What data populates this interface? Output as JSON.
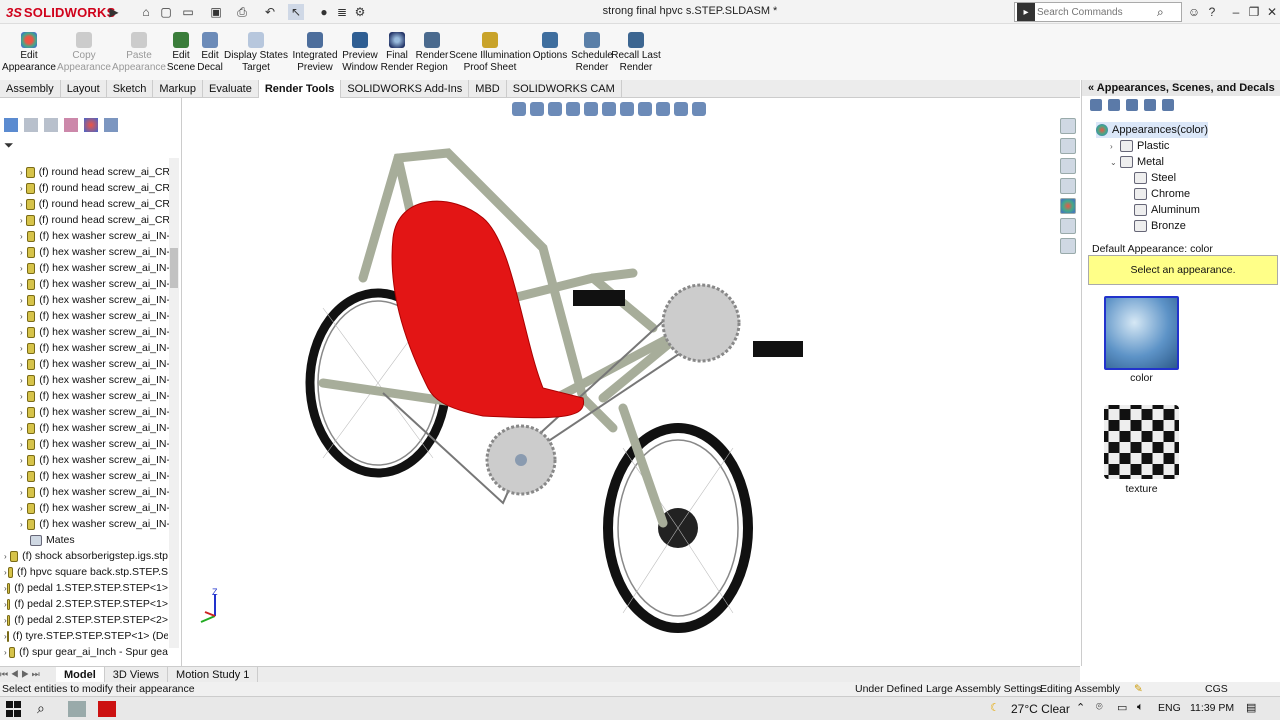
{
  "app": {
    "logo_ds": "3S",
    "logo_sw": "SOLIDWORKS",
    "doc_title": "strong final hpvc s.STEP.SLDASM *"
  },
  "search": {
    "placeholder": "Search Commands"
  },
  "commands": [
    {
      "label": "Edit\nAppearance",
      "enabled": true
    },
    {
      "label": "Copy\nAppearance",
      "enabled": false
    },
    {
      "label": "Paste\nAppearance",
      "enabled": false
    },
    {
      "label": "Edit\nScene",
      "enabled": true
    },
    {
      "label": "Edit\nDecal",
      "enabled": true
    },
    {
      "label": "Display States\nTarget",
      "enabled": true
    },
    {
      "label": "Integrated\nPreview",
      "enabled": true
    },
    {
      "label": "Preview\nWindow",
      "enabled": true
    },
    {
      "label": "Final\nRender",
      "enabled": true
    },
    {
      "label": "Render\nRegion",
      "enabled": true
    },
    {
      "label": "Scene Illumination\nProof Sheet",
      "enabled": true
    },
    {
      "label": "Options",
      "enabled": true
    },
    {
      "label": "Schedule\nRender",
      "enabled": true
    },
    {
      "label": "Recall Last\nRender",
      "enabled": true
    }
  ],
  "tabs": [
    "Assembly",
    "Layout",
    "Sketch",
    "Markup",
    "Evaluate",
    "Render Tools",
    "SOLIDWORKS Add-Ins",
    "MBD",
    "SOLIDWORKS CAM"
  ],
  "active_tab": "Render Tools",
  "tree": {
    "nested_items": [
      "(f) round head screw_ai_CR",
      "(f) round head screw_ai_CR",
      "(f) round head screw_ai_CR",
      "(f) round head screw_ai_CR",
      "(f) hex washer screw_ai_IN-",
      "(f) hex washer screw_ai_IN-",
      "(f) hex washer screw_ai_IN-",
      "(f) hex washer screw_ai_IN-",
      "(f) hex washer screw_ai_IN-",
      "(f) hex washer screw_ai_IN-",
      "(f) hex washer screw_ai_IN-",
      "(f) hex washer screw_ai_IN-",
      "(f) hex washer screw_ai_IN-",
      "(f) hex washer screw_ai_IN-",
      "(f) hex washer screw_ai_IN-",
      "(f) hex washer screw_ai_IN-",
      "(f) hex washer screw_ai_IN-",
      "(f) hex washer screw_ai_IN-",
      "(f) hex washer screw_ai_IN-",
      "(f) hex washer screw_ai_IN-",
      "(f) hex washer screw_ai_IN-",
      "(f) hex washer screw_ai_IN-",
      "(f) hex washer screw_ai_IN-"
    ],
    "mates": "Mates",
    "top_items": [
      "(f) shock absorberigstep.igs.stp",
      "(f) hpvc square back.stp.STEP.S",
      "(f) pedal 1.STEP.STEP.STEP<1>",
      "(f) pedal 2.STEP.STEP.STEP<1>",
      "(f) pedal 2.STEP.STEP.STEP<2>",
      "(f) tyre.STEP.STEP.STEP<1> (De",
      "(f) spur gear_ai_Inch - Spur gea"
    ]
  },
  "taskpane": {
    "title": "Appearances, Scenes, and Decals",
    "root": "Appearances(color)",
    "items": [
      {
        "label": "Plastic",
        "level": 1
      },
      {
        "label": "Metal",
        "level": 1
      },
      {
        "label": "Steel",
        "level": 2
      },
      {
        "label": "Chrome",
        "level": 2
      },
      {
        "label": "Aluminum",
        "level": 2
      },
      {
        "label": "Bronze",
        "level": 2
      }
    ],
    "default_label": "Default Appearance: color",
    "hint": "Select an appearance.",
    "swatches": [
      "color",
      "texture"
    ]
  },
  "bottom_tabs": [
    "Model",
    "3D Views",
    "Motion Study 1"
  ],
  "status": {
    "message": "Select entities to modify their appearance",
    "under_defined": "Under Defined",
    "large_assembly": "Large Assembly Settings",
    "editing": "Editing Assembly",
    "units": "CGS"
  },
  "taskbar": {
    "weather": "27°C  Clear",
    "lang": "ENG",
    "time": "11:39 PM"
  },
  "colors": {
    "seat": "#e31515",
    "frame": "#a7ad9a",
    "accent": "#d0021b",
    "selection": "#ffff88"
  }
}
